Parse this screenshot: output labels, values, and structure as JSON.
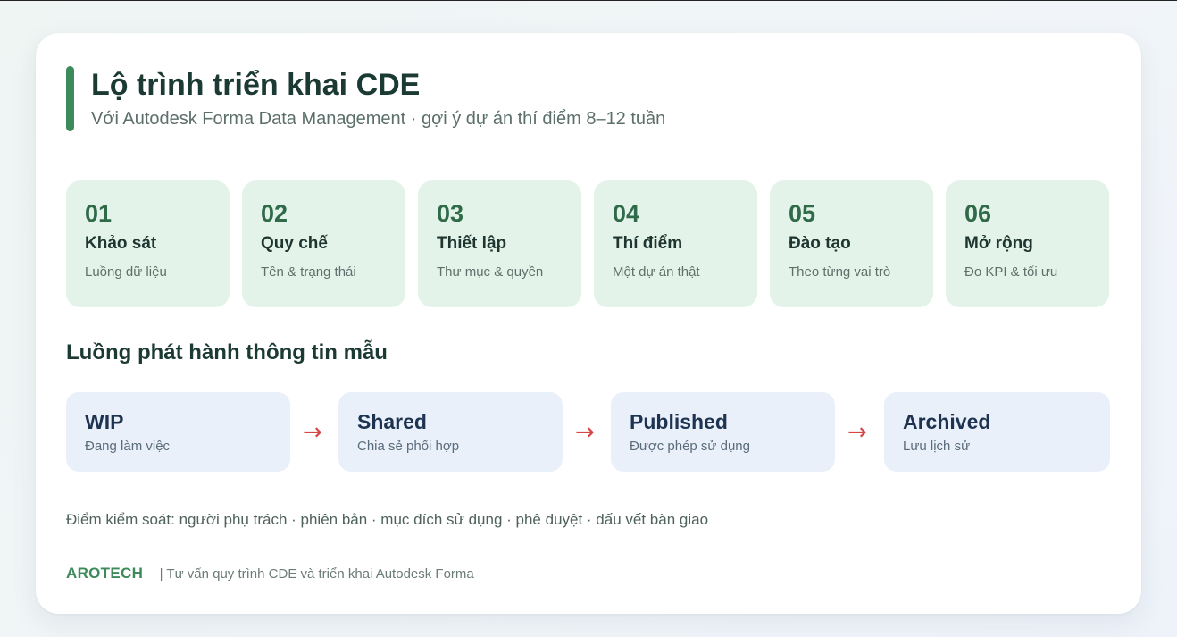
{
  "colors": {
    "accent": "#3d8a5a",
    "step_number": "#2f6b48",
    "step_bg": "#e4f3ea",
    "flow_bg": "#e9f0fa",
    "arrow": "#d64545"
  },
  "header": {
    "title": "Lộ trình triển khai CDE",
    "subtitle": "Với Autodesk Forma Data Management · gợi ý dự án thí điểm 8–12 tuần"
  },
  "steps": [
    {
      "number": "01",
      "title": "Khảo sát",
      "desc": "Luồng dữ liệu"
    },
    {
      "number": "02",
      "title": "Quy chế",
      "desc": "Tên & trạng thái"
    },
    {
      "number": "03",
      "title": "Thiết lập",
      "desc": "Thư mục & quyền"
    },
    {
      "number": "04",
      "title": "Thí điểm",
      "desc": "Một dự án thật"
    },
    {
      "number": "05",
      "title": "Đào tạo",
      "desc": "Theo từng vai trò"
    },
    {
      "number": "06",
      "title": "Mở rộng",
      "desc": "Đo KPI & tối ưu"
    }
  ],
  "flow": {
    "heading": "Luồng phát hành thông tin mẫu",
    "arrow_icon": "arrow-right-icon",
    "arrow_glyph": "→",
    "stages": [
      {
        "label": "WIP",
        "desc": "Đang làm việc"
      },
      {
        "label": "Shared",
        "desc": "Chia sẻ phối hợp"
      },
      {
        "label": "Published",
        "desc": "Được phép sử dụng"
      },
      {
        "label": "Archived",
        "desc": "Lưu lịch sử"
      }
    ]
  },
  "controls_text": "Điểm kiểm soát: người phụ trách · phiên bản · mục đích sử dụng · phê duyệt · dấu vết bàn giao",
  "footer": {
    "brand": "AROTECH",
    "tagline": "| Tư vấn quy trình CDE và triển khai Autodesk Forma"
  }
}
